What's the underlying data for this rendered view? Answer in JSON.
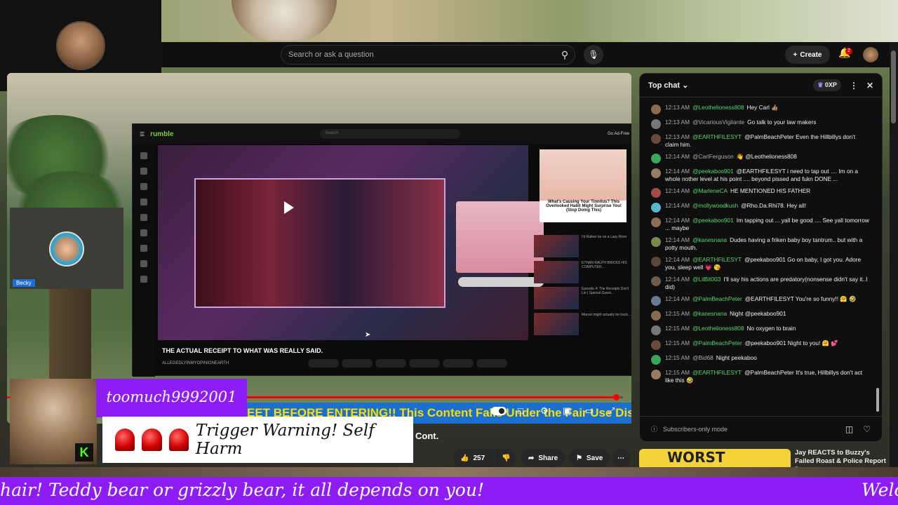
{
  "overlay": {
    "streamer_name": "toomuch9992001",
    "warning_text": "Trigger Warning! Self Harm",
    "guest_name": "Becky",
    "banner_text": "hair! Teddy bear or grizzly bear, it all depends on you!",
    "banner_tail": "Welc",
    "kick_letter": "K"
  },
  "youtube": {
    "search_placeholder": "Search or ask a question",
    "create_label": "Create",
    "notification_count": "2",
    "video_title_tail": "Cont.",
    "ticker_text": "EET BEFORE ENTERING!! This Content Falls Under the Fair Use Dis",
    "like_count": "257",
    "share_label": "Share",
    "save_label": "Save",
    "progress_fraction": 0.99
  },
  "rumble": {
    "logo": "rumble",
    "search_placeholder": "Search",
    "go_ad_free": "Go Ad-Free",
    "video_title": "THE ACTUAL RECEIPT TO WHAT WAS REALLY SAID.",
    "channel": "ALLEGEDLYINMYOPINIONEARTH",
    "ad_text": "What's Causing Your Tinnitus? This Overlooked Habit Might Surprise You! (Stop Doing This)",
    "side_items": [
      "I'd Rather be on a Lazy River",
      "ETHAN RALPH BRICKS HIS COMPUTER...",
      "Episode 4: The Receipts Don't Lie | Special Guest...",
      "Marvel might actually be back..."
    ]
  },
  "chat": {
    "header": "Top chat",
    "xp_label": "0XP",
    "footer_mode": "Subscribers-only mode",
    "messages": [
      {
        "time": "12:13 AM",
        "author": "@Leothelioness808",
        "text": "Hey Carl 👍🏽",
        "color": "green"
      },
      {
        "time": "12:13 AM",
        "author": "@VicariousVigilante",
        "text": "Go talk to your law makers",
        "color": "gray"
      },
      {
        "time": "12:13 AM",
        "author": "@EARTHFILESYT",
        "text": "@PalmBeachPeter Even the Hillbillys don't claim him.",
        "color": "green"
      },
      {
        "time": "12:14 AM",
        "author": "@CarlFerguson",
        "text": "👋 @Leothelioness808",
        "color": "gray"
      },
      {
        "time": "12:14 AM",
        "author": "@peekaboo901",
        "text": "@EARTHFILESYT i need to tap out .... Im on a whole nother level at his point .... beyond pissed and fukn DONE ...",
        "color": "green"
      },
      {
        "time": "12:14 AM",
        "author": "@MarleneCA",
        "text": "HE MENTIONED HIS FATHER",
        "color": "green"
      },
      {
        "time": "12:14 AM",
        "author": "@mollywoodkush",
        "text": "@Rho.Da.Rhi78. Hey all!",
        "color": "green"
      },
      {
        "time": "12:14 AM",
        "author": "@peekaboo901",
        "text": "Im tapping out ... yall be good .... See yall tomorrow ... maybe",
        "color": "green"
      },
      {
        "time": "12:14 AM",
        "author": "@kanesnana",
        "text": "Dudes having a friken baby boy tantrum.. but with a potty mouth.",
        "color": "green"
      },
      {
        "time": "12:14 AM",
        "author": "@EARTHFILESYT",
        "text": "@peekaboo901 Go on baby, I got you. Adore you, sleep well 💗 😘",
        "color": "green"
      },
      {
        "time": "12:14 AM",
        "author": "@LilBit003",
        "text": "I'll say his actions are predatory(nonsense didn't say it..I did)",
        "color": "green"
      },
      {
        "time": "12:14 AM",
        "author": "@PalmBeachPeter",
        "text": "@EARTHFILESYT You're so funny!! 🤗 🤣",
        "color": "green"
      },
      {
        "time": "12:15 AM",
        "author": "@kanesnana",
        "text": "Night @peekaboo901",
        "color": "green"
      },
      {
        "time": "12:15 AM",
        "author": "@Leothelioness808",
        "text": "No oxygen to brain",
        "color": "green"
      },
      {
        "time": "12:15 AM",
        "author": "@PalmBeachPeter",
        "text": "@peekaboo901 Night to you! 🤗 💕",
        "color": "green"
      },
      {
        "time": "12:15 AM",
        "author": "@Bid68",
        "text": "Night peekaboo",
        "color": "gray"
      },
      {
        "time": "12:15 AM",
        "author": "@EARTHFILESYT",
        "text": "@PalmBeachPeter It's true, Hillbillys don't act like this 🤣",
        "color": "green"
      }
    ]
  },
  "recommendation": {
    "thumb_text": "WORST",
    "title": "Jay REACTS to Buzzy's Failed Roast & Police Report Drama"
  },
  "colors": {
    "purple": "#8d1cf5",
    "accent_red": "#ff0000",
    "chat_green": "#5bd36f"
  }
}
